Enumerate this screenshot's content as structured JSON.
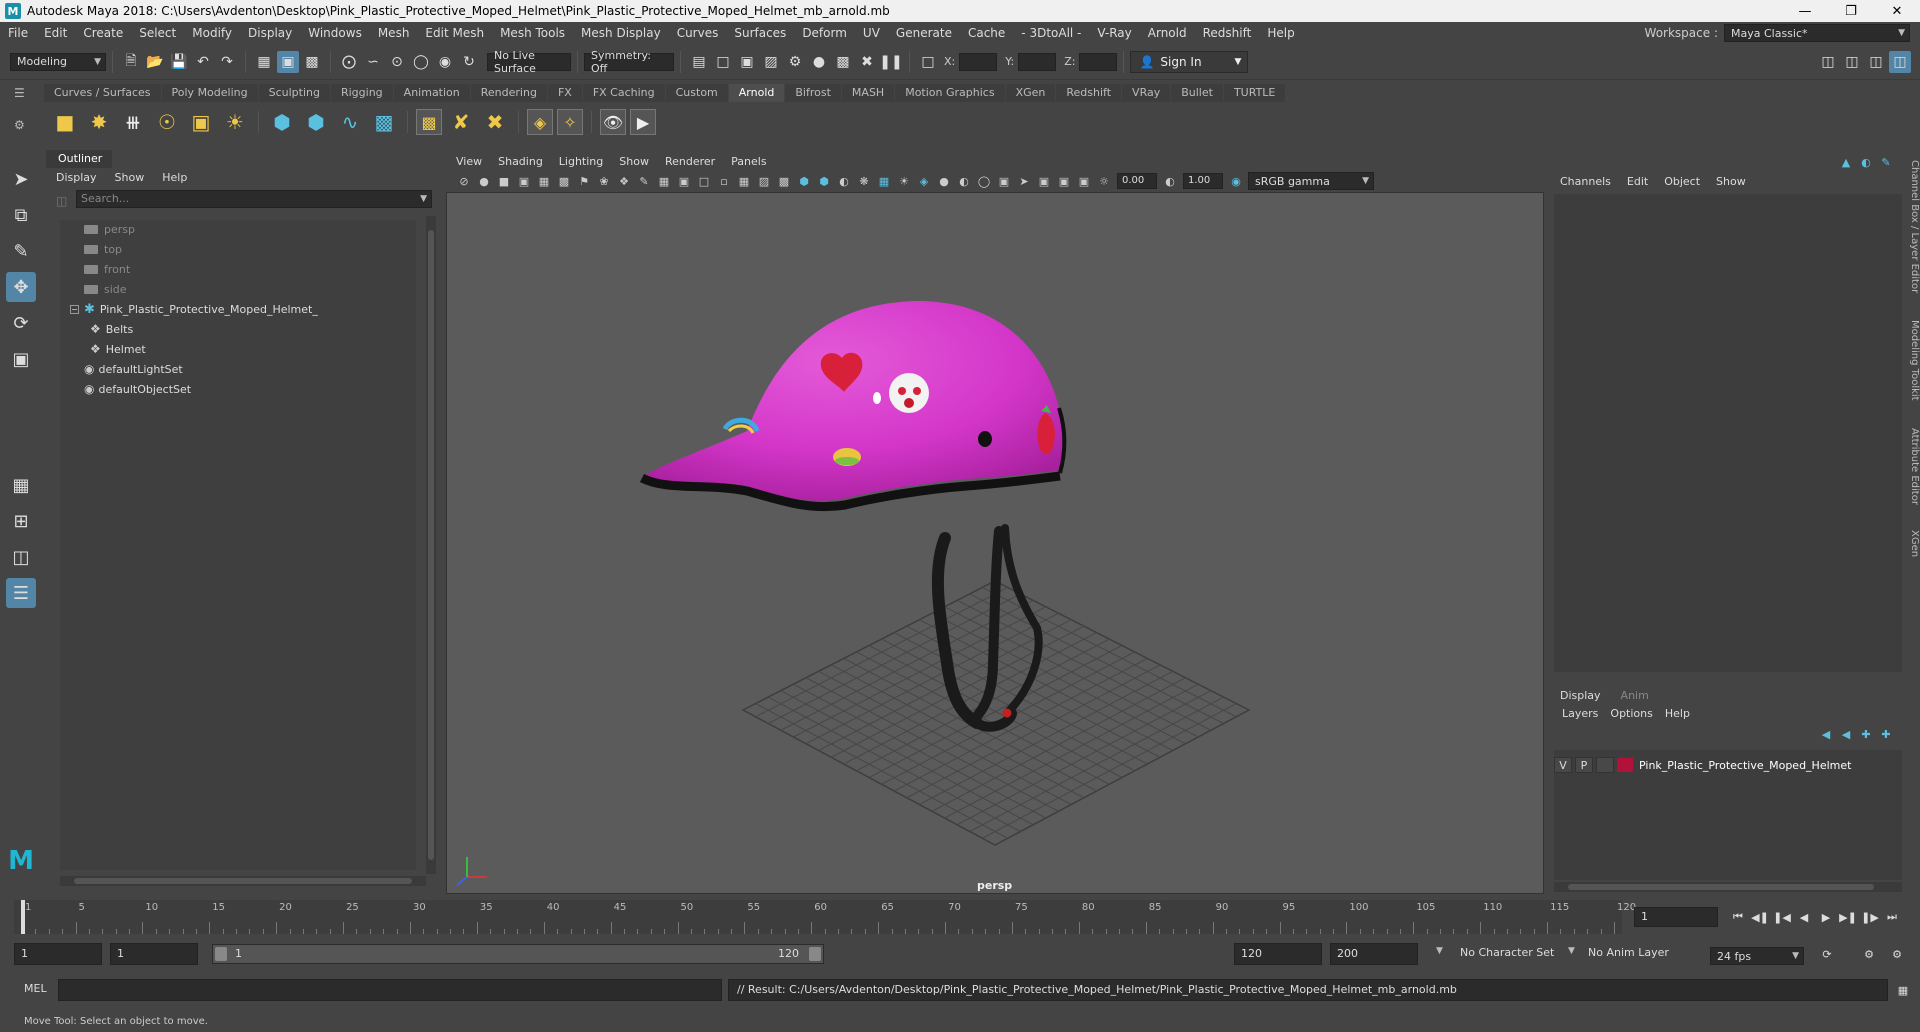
{
  "window": {
    "title": "Autodesk Maya 2018: C:\\Users\\Avdenton\\Desktop\\Pink_Plastic_Protective_Moped_Helmet\\Pink_Plastic_Protective_Moped_Helmet_mb_arnold.mb",
    "app_letter": "M"
  },
  "menus": [
    "File",
    "Edit",
    "Create",
    "Select",
    "Modify",
    "Display",
    "Windows",
    "Mesh",
    "Edit Mesh",
    "Mesh Tools",
    "Mesh Display",
    "Curves",
    "Surfaces",
    "Deform",
    "UV",
    "Generate",
    "Cache",
    "- 3DtoAll -",
    "V-Ray",
    "Arnold",
    "Redshift",
    "Help"
  ],
  "workspace": {
    "label": "Workspace :",
    "value": "Maya Classic*"
  },
  "statusline": {
    "mode": "Modeling",
    "live_surface": "No Live Surface",
    "symmetry": "Symmetry: Off",
    "x_label": "X:",
    "y_label": "Y:",
    "z_label": "Z:",
    "sign_in": "Sign In"
  },
  "shelf_tabs": [
    "Curves / Surfaces",
    "Poly Modeling",
    "Sculpting",
    "Rigging",
    "Animation",
    "Rendering",
    "FX",
    "FX Caching",
    "Custom",
    "Arnold",
    "Bifrost",
    "MASH",
    "Motion Graphics",
    "XGen",
    "Redshift",
    "VRay",
    "Bullet",
    "TURTLE"
  ],
  "shelf_active": "Arnold",
  "outliner": {
    "title": "Outliner",
    "menu": [
      "Display",
      "Show",
      "Help"
    ],
    "search_placeholder": "Search...",
    "items": {
      "persp": "persp",
      "top": "top",
      "front": "front",
      "side": "side",
      "group": "Pink_Plastic_Protective_Moped_Helmet_",
      "belts": "Belts",
      "helmet": "Helmet",
      "light_set": "defaultLightSet",
      "object_set": "defaultObjectSet"
    }
  },
  "viewport": {
    "menu": [
      "View",
      "Shading",
      "Lighting",
      "Show",
      "Renderer",
      "Panels"
    ],
    "exposure": "0.00",
    "gamma": "1.00",
    "color_space": "sRGB gamma",
    "camera_label": "persp"
  },
  "channelbox": {
    "menu": [
      "Channels",
      "Edit",
      "Object",
      "Show"
    ]
  },
  "side_tabs": [
    "Channel Box / Layer Editor",
    "Modeling Toolkit",
    "Attribute Editor",
    "XGen"
  ],
  "layer_editor": {
    "tabs": [
      "Display",
      "Anim"
    ],
    "menu": [
      "Layers",
      "Options",
      "Help"
    ],
    "layer": {
      "v": "V",
      "p": "P",
      "name": "Pink_Plastic_Protective_Moped_Helmet",
      "color": "#b0123a"
    }
  },
  "timeline": {
    "ticks": [
      "1",
      "5",
      "10",
      "15",
      "20",
      "25",
      "30",
      "35",
      "40",
      "45",
      "50",
      "55",
      "60",
      "65",
      "70",
      "75",
      "80",
      "85",
      "90",
      "95",
      "100",
      "105",
      "110",
      "115",
      "120"
    ],
    "current_frame": "1"
  },
  "range": {
    "start": "1",
    "playback_start": "1",
    "slider_start": "1",
    "slider_end": "120",
    "playback_end": "120",
    "end": "200",
    "character_set": "No Character Set",
    "anim_layer": "No Anim Layer",
    "fps": "24 fps"
  },
  "command": {
    "lang": "MEL",
    "result": "// Result: C:/Users/Avdenton/Desktop/Pink_Plastic_Protective_Moped_Helmet/Pink_Plastic_Protective_Moped_Helmet_mb_arnold.mb"
  },
  "help_line": "Move Tool: Select an object to move.",
  "colors": {
    "helmet": "#d336c8",
    "accent": "#5285a6",
    "layer": "#b0123a"
  }
}
